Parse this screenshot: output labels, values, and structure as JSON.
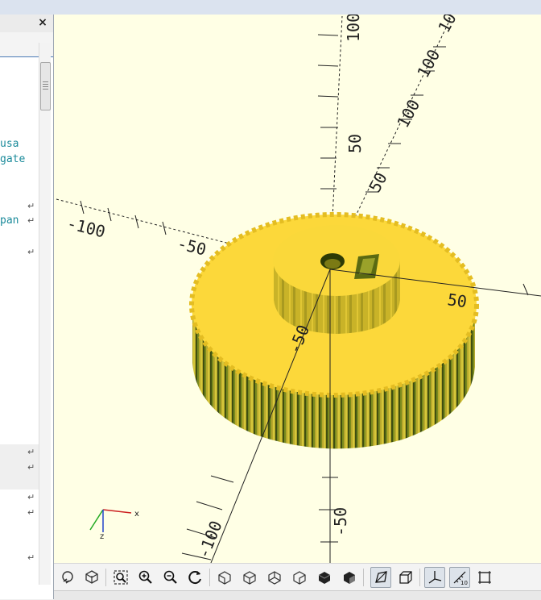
{
  "editor": {
    "close_label": "×",
    "lines": [
      {
        "text": "usa"
      },
      {
        "text": "gate"
      },
      {
        "text": "pan"
      }
    ],
    "wrap_icon": "↵"
  },
  "viewport": {
    "axis_labels": {
      "x_pos": "50",
      "x_neg": "-50",
      "y_pos": "50",
      "z_pos": "50",
      "z_neg": "-50",
      "y_far": "100",
      "y_near": "-100",
      "z_top": "100"
    },
    "gizmo": {
      "x": "x",
      "z": "z"
    },
    "colors": {
      "background": "#ffffe5",
      "model_top": "#fcd83a",
      "model_side": "#b8a62a",
      "model_dark": "#4a5a10"
    }
  },
  "toolbar": {
    "buttons": [
      {
        "name": "preview-button",
        "icon": "preview-icon"
      },
      {
        "name": "render-button",
        "icon": "render-icon"
      },
      {
        "name": "view-all-button",
        "icon": "view-all-icon"
      },
      {
        "name": "zoom-in-button",
        "icon": "zoom-in-icon"
      },
      {
        "name": "zoom-out-button",
        "icon": "zoom-out-icon"
      },
      {
        "name": "reset-view-button",
        "icon": "reset-view-icon"
      },
      {
        "name": "view-right-button",
        "icon": "view-right-icon"
      },
      {
        "name": "view-top-button",
        "icon": "view-top-icon"
      },
      {
        "name": "view-bottom-button",
        "icon": "view-bottom-icon"
      },
      {
        "name": "view-left-button",
        "icon": "view-left-icon"
      },
      {
        "name": "view-front-button",
        "icon": "view-front-icon"
      },
      {
        "name": "view-back-button",
        "icon": "view-back-icon"
      },
      {
        "name": "perspective-button",
        "icon": "perspective-icon"
      },
      {
        "name": "orthogonal-button",
        "icon": "orthogonal-icon"
      },
      {
        "name": "show-axes-button",
        "icon": "axes-icon"
      },
      {
        "name": "show-scale-button",
        "icon": "scale-markers-icon"
      },
      {
        "name": "show-edges-button",
        "icon": "edges-icon"
      }
    ],
    "scale_badge": "10"
  }
}
